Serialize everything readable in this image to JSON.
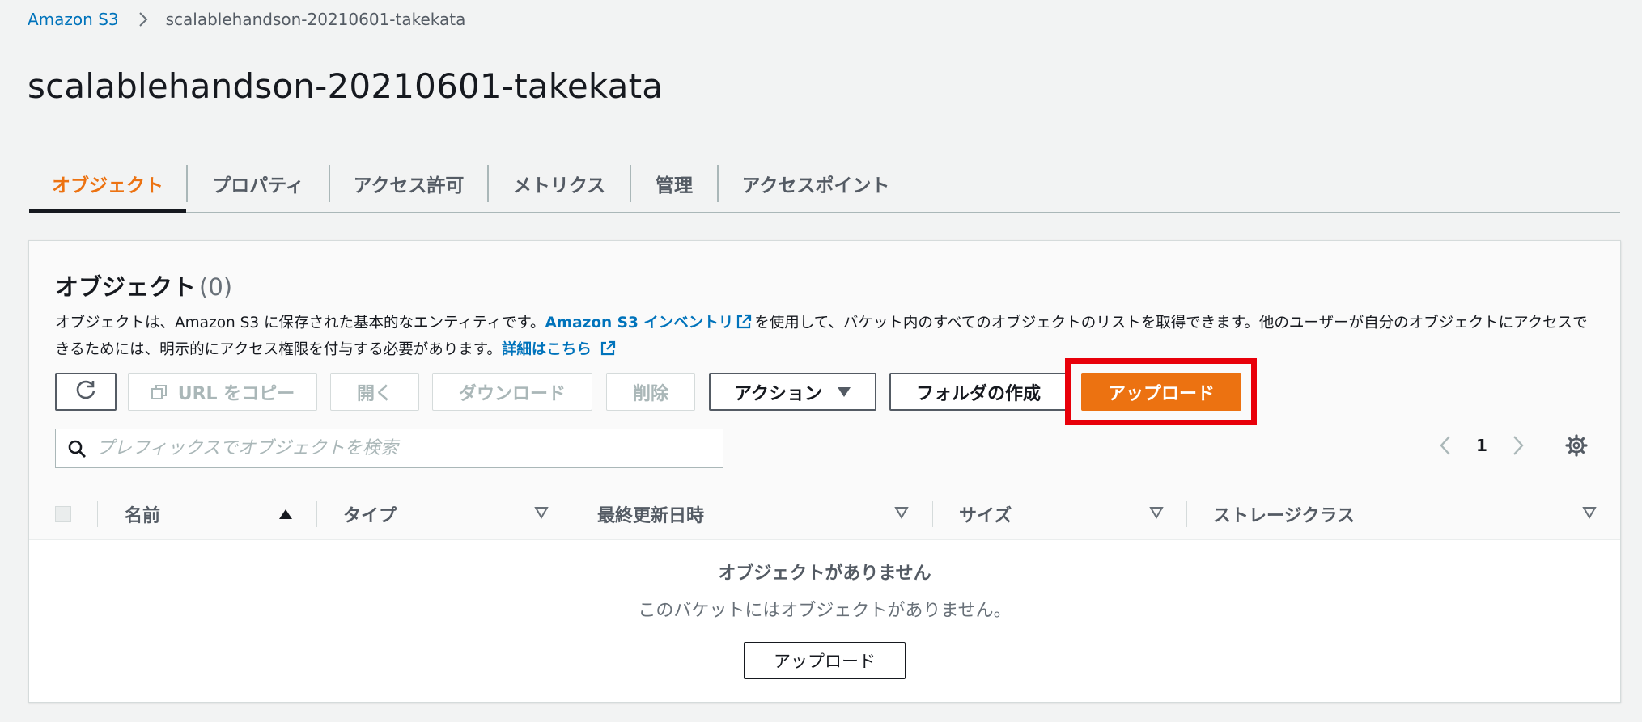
{
  "breadcrumb": {
    "root": "Amazon S3",
    "current": "scalablehandson-20210601-takekata"
  },
  "page_title": "scalablehandson-20210601-takekata",
  "tabs": [
    "オブジェクト",
    "プロパティ",
    "アクセス許可",
    "メトリクス",
    "管理",
    "アクセスポイント"
  ],
  "active_tab": "オブジェクト",
  "objects": {
    "title": "オブジェクト",
    "count": "(0)",
    "desc_part1": "オブジェクトは、Amazon S3 に保存された基本的なエンティティです。",
    "desc_link1": "Amazon S3 インベントリ",
    "desc_part2": "を使用して、バケット内のすべてのオブジェクトのリストを取得できます。他のユーザーが自分のオブジェクトにアクセスできるためには、明示的にアクセス権限を付与する必要があります。",
    "desc_link2": "詳細はこちら"
  },
  "toolbar": {
    "copy_url": "URL をコピー",
    "open": "開く",
    "download": "ダウンロード",
    "delete": "削除",
    "actions": "アクション",
    "create_folder": "フォルダの作成",
    "upload": "アップロード"
  },
  "search": {
    "placeholder": "プレフィックスでオブジェクトを検索"
  },
  "pagination": {
    "page": "1"
  },
  "table": {
    "columns": [
      "名前",
      "タイプ",
      "最終更新日時",
      "サイズ",
      "ストレージクラス"
    ],
    "empty_title": "オブジェクトがありません",
    "empty_text": "このバケットにはオブジェクトがありません。",
    "empty_button": "アップロード"
  },
  "colors": {
    "accent": "#ec7211",
    "link": "#0073bb",
    "highlight": "#e8000a"
  }
}
